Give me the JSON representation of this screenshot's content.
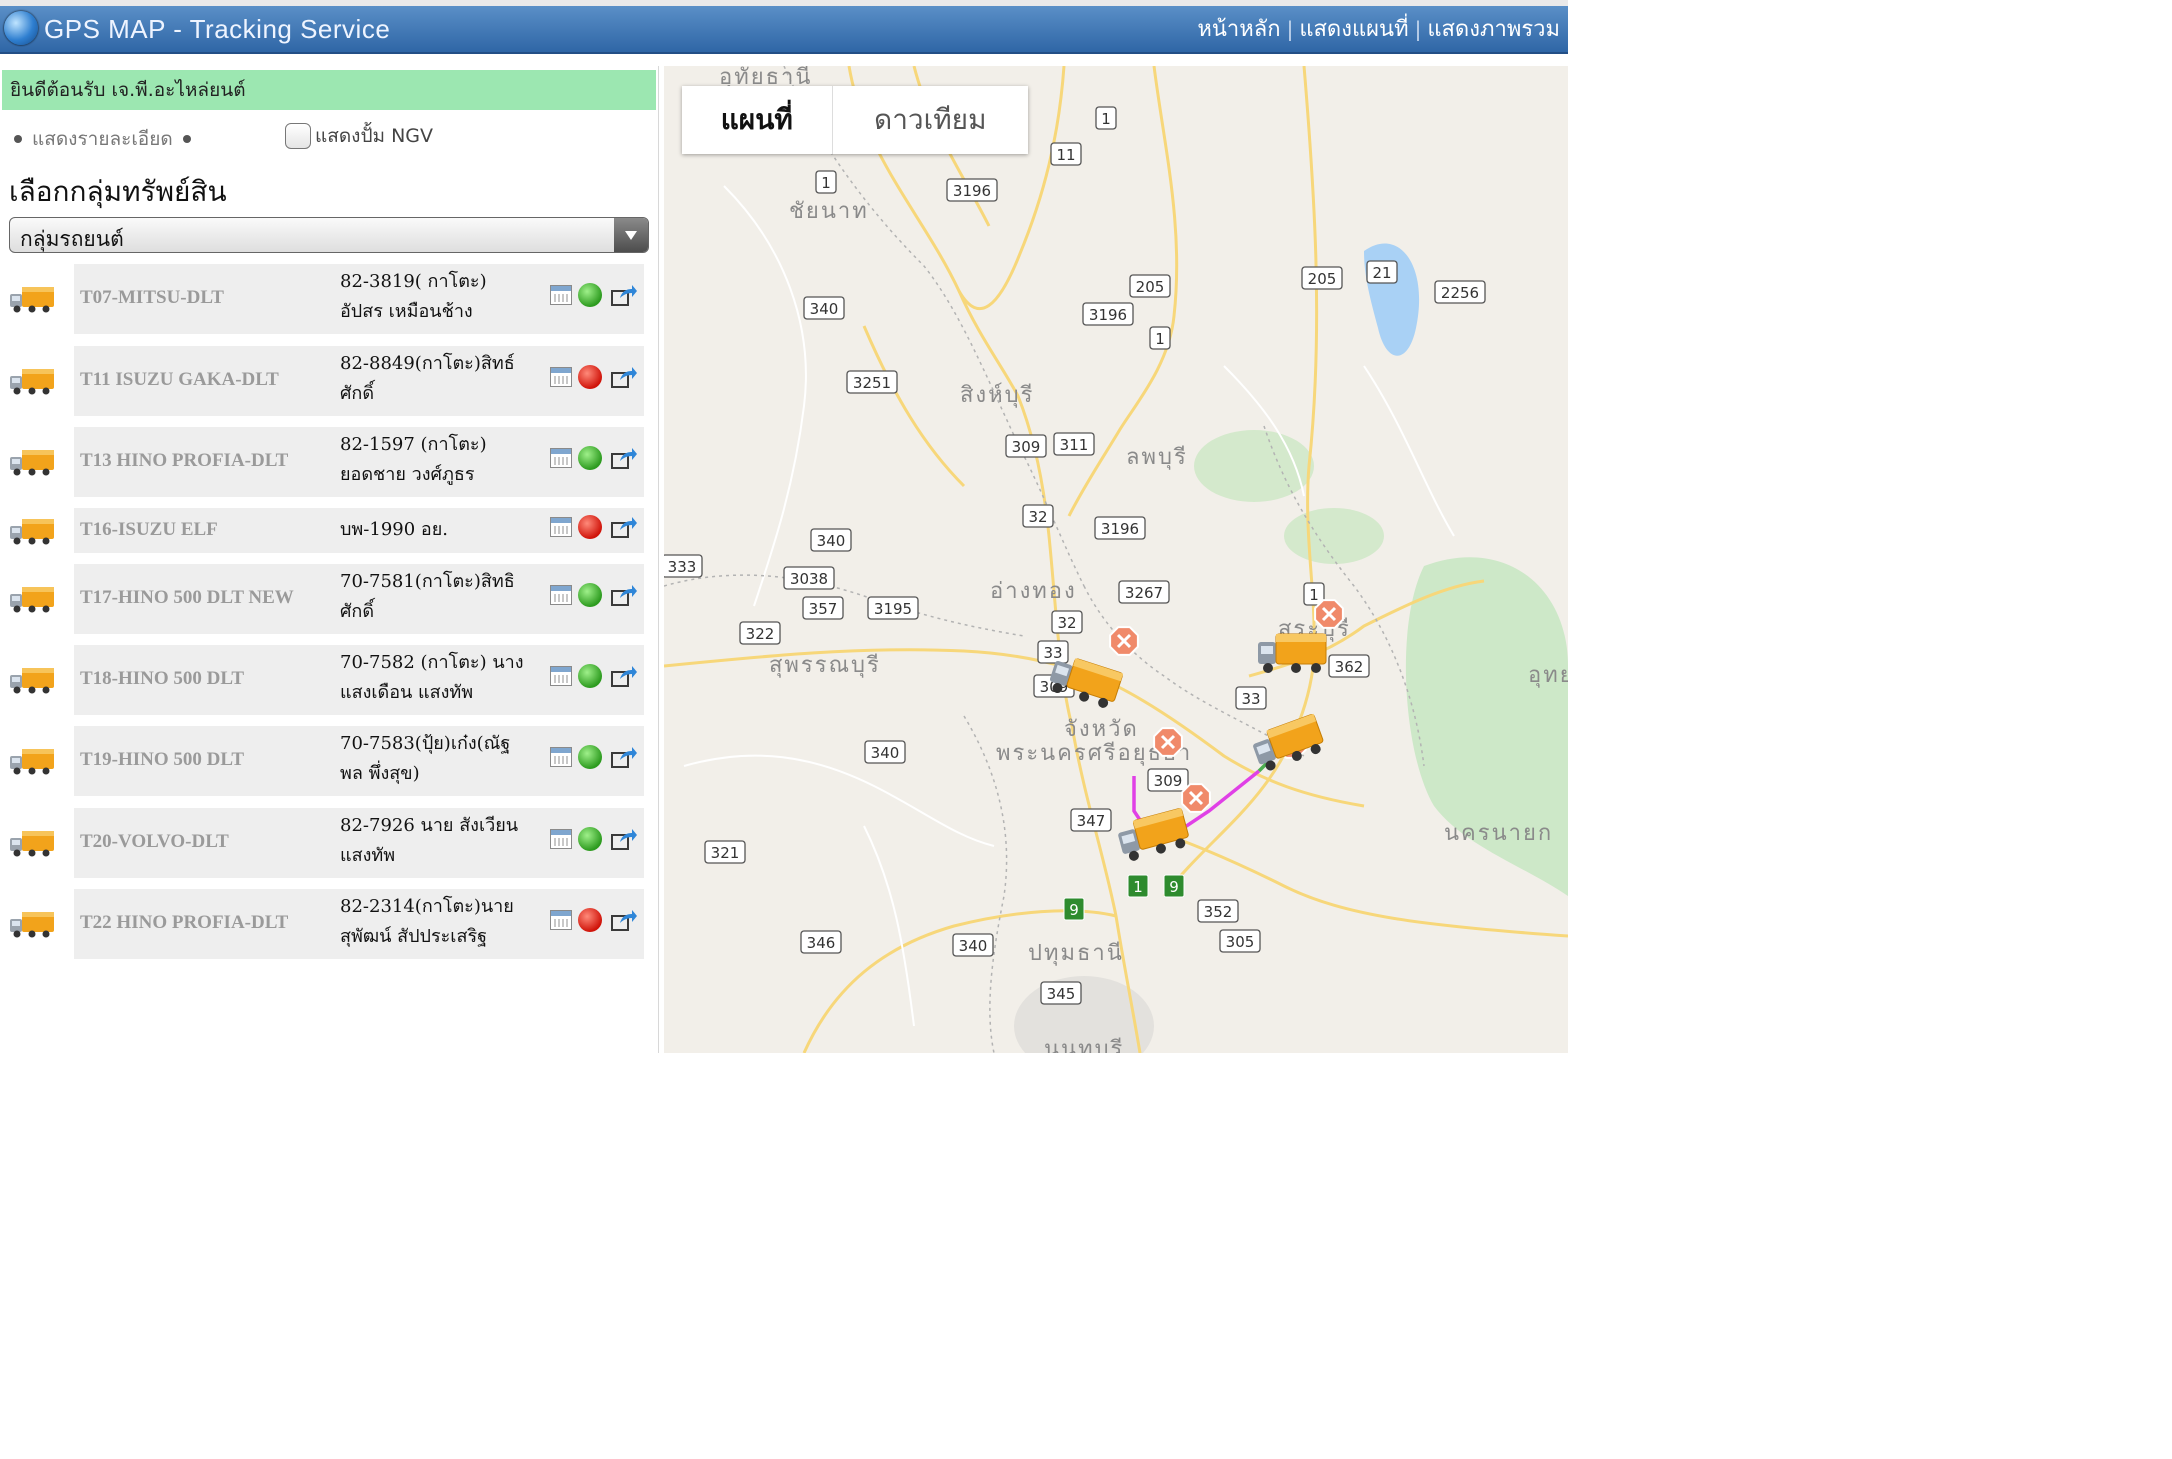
{
  "header": {
    "app_title": "GPS MAP - Tracking Service",
    "nav": [
      "หน้าหลัก",
      "แสดงแผนที่",
      "แสดงภาพรวม"
    ]
  },
  "sidebar": {
    "welcome": "ยินดีต้อนรับ เจ.พี.อะไหล่ยนต์",
    "show_detail": "แสดงรายละเอียด",
    "show_ngv": "แสดงปั้ม NGV",
    "group_heading": "เลือกกลุ่มทรัพย์สิน",
    "group_select": "กลุ่มรถยนต์",
    "vehicles": [
      {
        "name": "T07-MITSU-DLT",
        "info": "82-3819( กาโตะ)\nอัปสร เหมือนช้าง",
        "status": "green"
      },
      {
        "name": "T11 ISUZU GAKA-DLT",
        "info": " 82-8849(กาโตะ)สิทธ์\nศักดิ์",
        "status": "red"
      },
      {
        "name": "T13 HINO PROFIA-DLT",
        "info": "82-1597 (กาโตะ)\nยอดชาย วงศ์ภูธร",
        "status": "green"
      },
      {
        "name": "T16-ISUZU ELF",
        "info": "บพ-1990 อย.",
        "status": "red"
      },
      {
        "name": "T17-HINO 500 DLT NEW",
        "info": "70-7581(กาโตะ)สิทธิ\nศักดิ์",
        "status": "green"
      },
      {
        "name": "T18-HINO 500 DLT",
        "info": "70-7582 (กาโตะ) นาง\nแสงเดือน แสงทัพ",
        "status": "green"
      },
      {
        "name": "T19-HINO 500 DLT",
        "info": "70-7583(ปุ้ย)เก๋ง(ณัฐ\nพล พึ่งสุข)",
        "status": "green"
      },
      {
        "name": "T20-VOLVO-DLT",
        "info": "82-7926 นาย สังเวียน\nแสงทัพ",
        "status": "green"
      },
      {
        "name": "T22 HINO PROFIA-DLT",
        "info": "82-2314(กาโตะ)นาย\nสุพัฒน์ สัปประเสริฐ",
        "status": "red"
      }
    ]
  },
  "map": {
    "tab_map": "แผนที่",
    "tab_satellite": "ดาวเทียม",
    "places": [
      "อุทัยธานี",
      "ชัยนาท",
      "สิงห์บุรี",
      "ลพบุรี",
      "อ่างทอง",
      "สระบุรี",
      "สุพรรณบุรี",
      "จังหวัด",
      "พระนครศรีอยุธยา",
      "นครนายก",
      "ปทุมธานี",
      "อุทย",
      "นนทบุรี"
    ],
    "route_shields": [
      "1",
      "11",
      "1",
      "3196",
      "205",
      "21",
      "205",
      "2256",
      "340",
      "3196",
      "1",
      "3251",
      "309",
      "311",
      "32",
      "3196",
      "340",
      "333",
      "3038",
      "357",
      "3195",
      "3267",
      "1",
      "322",
      "32",
      "33",
      "362",
      "309",
      "33",
      "340",
      "309",
      "347",
      "321",
      "352",
      "346",
      "340",
      "305",
      "345"
    ],
    "green_shields": [
      "1",
      "9",
      "9"
    ],
    "colors": {
      "route_magenta": "#e040e6",
      "route_green": "#4caf50",
      "water": "#a9d1f5",
      "park": "#cde8c8",
      "highway": "#f7d77a"
    }
  }
}
